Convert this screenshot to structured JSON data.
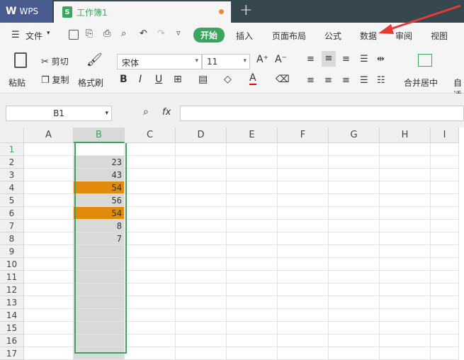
{
  "titlebar": {
    "app_name": "WPS",
    "doc_tab": "工作簿1"
  },
  "menu": {
    "file": "文件",
    "start": "开始",
    "items": [
      "插入",
      "页面布局",
      "公式",
      "数据",
      "审阅",
      "视图"
    ]
  },
  "ribbon": {
    "paste": "粘贴",
    "cut": "剪切",
    "copy": "复制",
    "format_painter": "格式刷",
    "font_name": "宋体",
    "font_size": "11",
    "bold": "B",
    "italic": "I",
    "underline": "U",
    "merge_center": "合并居中",
    "auto": "自适"
  },
  "formula_bar": {
    "name_box": "B1",
    "fx": "fx"
  },
  "sheet": {
    "columns": [
      "A",
      "B",
      "C",
      "D",
      "E",
      "F",
      "G",
      "H",
      "I"
    ],
    "selected_column": "B",
    "rows": [
      "1",
      "2",
      "3",
      "4",
      "5",
      "6",
      "7",
      "8",
      "9",
      "10",
      "11",
      "12",
      "13",
      "14",
      "15",
      "16",
      "17"
    ],
    "colB_values": [
      "",
      "23",
      "43",
      "54",
      "56",
      "54",
      "8",
      "7",
      "",
      "",
      "",
      "",
      "",
      "",
      "",
      "",
      ""
    ],
    "highlighted_rows": [
      4,
      6
    ],
    "highlight_color": "#e18a0b",
    "accent_color": "#3aa55d"
  }
}
